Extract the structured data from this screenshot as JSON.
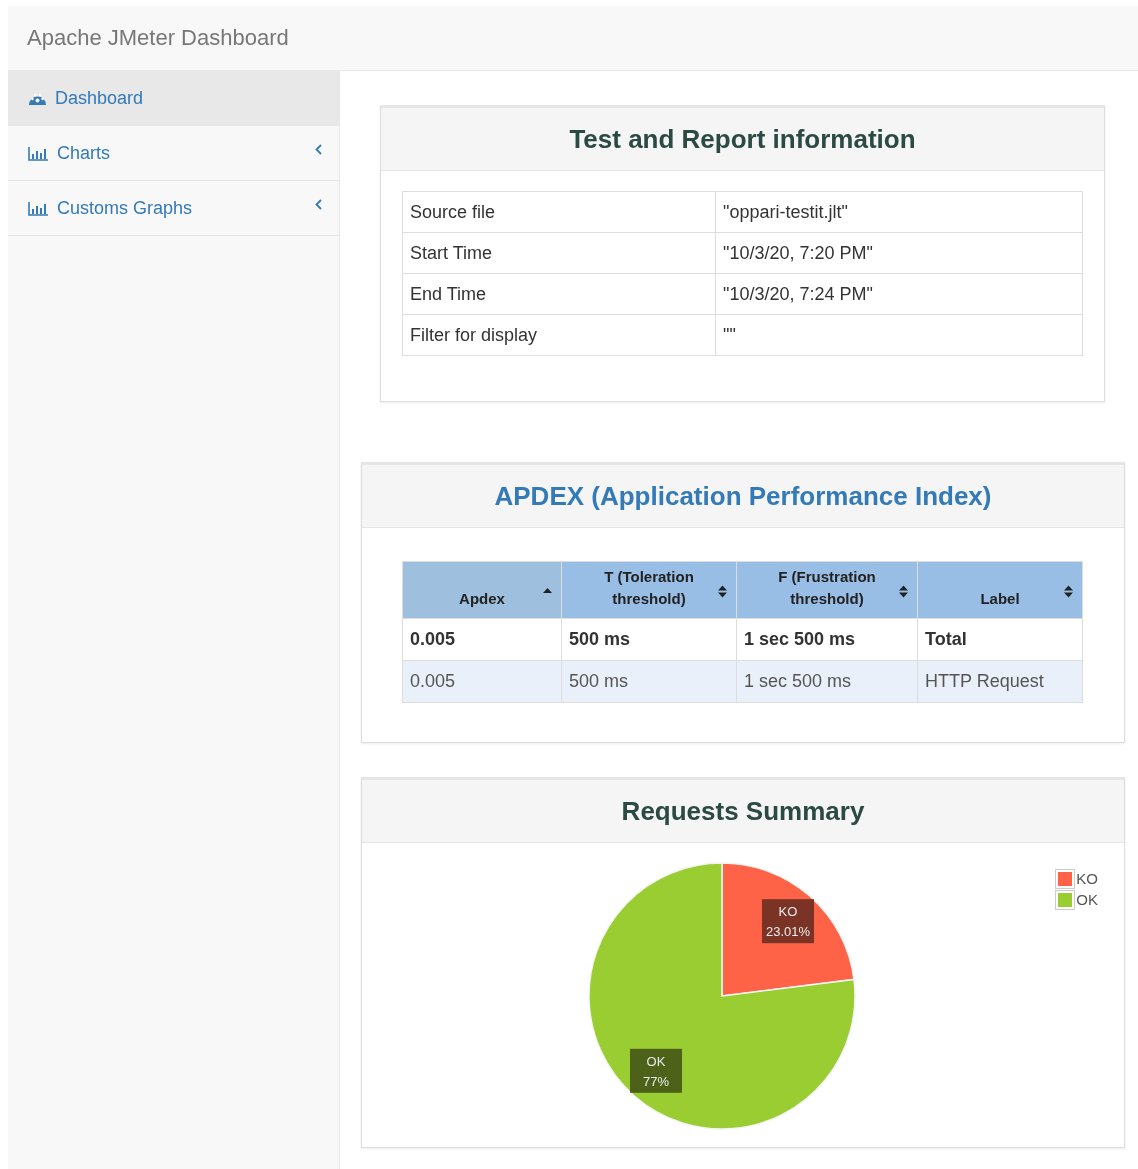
{
  "header": {
    "title": "Apache JMeter Dashboard"
  },
  "sidebar": {
    "items": [
      {
        "label": "Dashboard",
        "kind": "gauge",
        "selected": true,
        "expandable": false
      },
      {
        "label": "Charts",
        "kind": "bars",
        "selected": false,
        "expandable": true
      },
      {
        "label": "Customs Graphs",
        "kind": "bars",
        "selected": false,
        "expandable": true
      }
    ]
  },
  "info_panel": {
    "title": "Test and Report information",
    "rows": [
      {
        "name": "Source file",
        "value": "\"oppari-testit.jlt\""
      },
      {
        "name": "Start Time",
        "value": "\"10/3/20, 7:20 PM\""
      },
      {
        "name": "End Time",
        "value": "\"10/3/20, 7:24 PM\""
      },
      {
        "name": "Filter for display",
        "value": "\"\""
      }
    ]
  },
  "apdex_panel": {
    "title": "APDEX (Application Performance Index)",
    "columns": [
      {
        "label": "Apdex",
        "sorted": true
      },
      {
        "label": "T (Toleration threshold)",
        "sorted": false
      },
      {
        "label": "F (Frustration threshold)",
        "sorted": false
      },
      {
        "label": "Label",
        "sorted": false
      }
    ],
    "rows": [
      {
        "kind": "total",
        "cells": [
          "0.005",
          "500 ms",
          "1 sec 500 ms",
          "Total"
        ]
      },
      {
        "kind": "item",
        "cells": [
          "0.005",
          "500 ms",
          "1 sec 500 ms",
          "HTTP Request"
        ]
      }
    ]
  },
  "summary_panel": {
    "title": "Requests Summary",
    "legend": [
      {
        "label": "KO",
        "color": "#ff6347"
      },
      {
        "label": "OK",
        "color": "#9acd32"
      }
    ],
    "chart_data": {
      "type": "pie",
      "categories": [
        "KO",
        "OK"
      ],
      "values": [
        23.01,
        76.99
      ],
      "value_labels": [
        "23.01%",
        "77%"
      ]
    }
  }
}
